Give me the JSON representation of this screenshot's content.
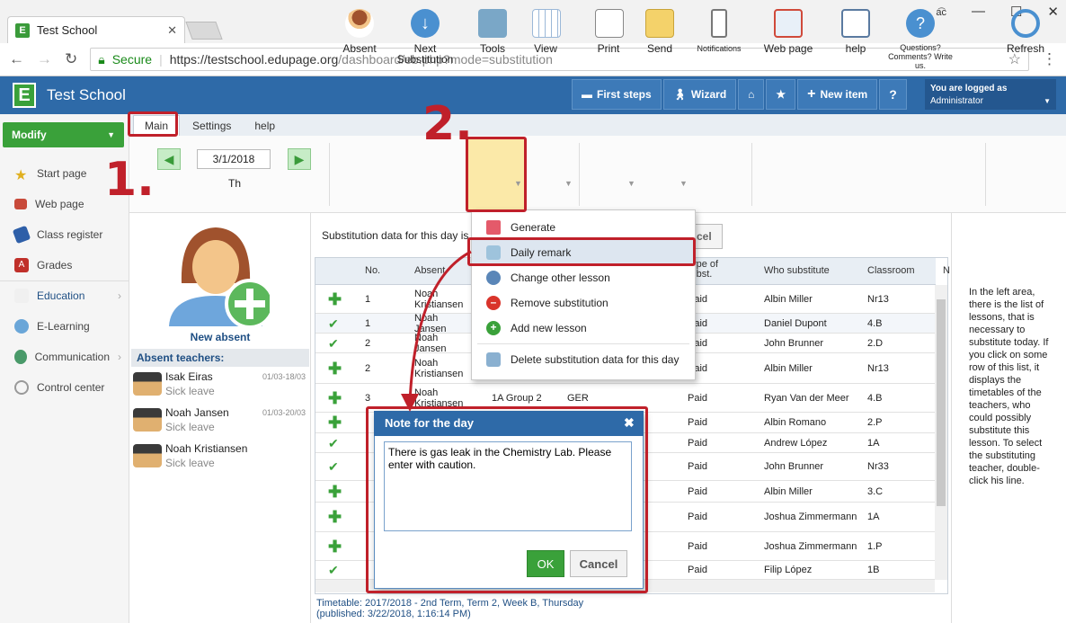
{
  "browser": {
    "tab_title": "Test School",
    "secure_label": "Secure",
    "url_base": "https://testschool.edupage.org",
    "url_path": "/dashboard/eb.php?mode=substitution",
    "win_label": "a͡c"
  },
  "app": {
    "title": "Test School",
    "top_buttons": [
      "First steps",
      "Wizard",
      "New item"
    ],
    "logged_in_label": "You are logged as",
    "logged_in_user": "Administrator"
  },
  "sidebar": {
    "modify_label": "Modify",
    "items": [
      "Start page",
      "Web page",
      "Class register",
      "Grades",
      "Education",
      "E-Learning",
      "Communication",
      "Control center"
    ]
  },
  "tabs": [
    "Main",
    "Settings",
    "help"
  ],
  "ribbon": {
    "date": "3/1/2018",
    "day": "Th",
    "absent": "Absent",
    "next_sub_1": "Next",
    "next_sub_2": "Substitution",
    "tools": "Tools",
    "view": "View",
    "print": "Print",
    "send": "Send",
    "notifications": "Notifications",
    "webpage": "Web page",
    "help": "help",
    "questions": "Questions? Comments? Write us.",
    "refresh": "Refresh"
  },
  "left_panel": {
    "new_absent": "New absent",
    "absent_header": "Absent teachers:",
    "teachers": [
      {
        "name": "Isak Eiras",
        "reason": "Sick leave",
        "dates": "01/03-18/03"
      },
      {
        "name": "Noah Jansen",
        "reason": "Sick leave",
        "dates": "01/03-20/03"
      },
      {
        "name": "Noah Kristiansen",
        "reason": "Sick leave",
        "dates": ""
      }
    ]
  },
  "main": {
    "subtitle": "Substitution data for this day is",
    "cancel_partial": "cel",
    "columns": {
      "no": "No.",
      "absent": "Absent",
      "type": "Type of subst.",
      "who": "Who substitute",
      "room": "Classroom",
      "n": "N"
    },
    "rows": [
      {
        "icon": "plus",
        "no": "1",
        "absent": "Noah Kristiansen",
        "group": "",
        "subj": "",
        "type": "Paid",
        "who": "Albin Miller",
        "room": "Nr13"
      },
      {
        "icon": "check",
        "no": "1",
        "absent": "Noah Jansen",
        "group": "",
        "subj": "",
        "type": "Paid",
        "who": "Daniel Dupont",
        "room": "4.B"
      },
      {
        "icon": "check",
        "no": "2",
        "absent": "Noah Jansen",
        "group": "",
        "subj": "",
        "type": "Paid",
        "who": "John Brunner",
        "room": "2.D"
      },
      {
        "icon": "plus",
        "no": "2",
        "absent": "Noah Kristiansen",
        "group": "",
        "subj": "",
        "type": "Paid",
        "who": "Albin Miller",
        "room": "Nr13"
      },
      {
        "icon": "plus",
        "no": "3",
        "absent": "Noah Kristiansen",
        "group": "1A Group 2",
        "subj": "GER",
        "type": "Paid",
        "who": "Ryan Van der Meer",
        "room": "4.B"
      },
      {
        "icon": "plus",
        "no": "",
        "absent": "",
        "group": "",
        "subj": "",
        "type": "Paid",
        "who": "Albin Romano",
        "room": "2.P"
      },
      {
        "icon": "check",
        "no": "",
        "absent": "",
        "group": "",
        "subj": "",
        "type": "Paid",
        "who": "Andrew López",
        "room": "1A"
      },
      {
        "icon": "check",
        "no": "",
        "absent": "",
        "group": "",
        "subj": "",
        "type": "Paid",
        "who": "John Brunner",
        "room": "Nr33"
      },
      {
        "icon": "plus",
        "no": "",
        "absent": "",
        "group": "",
        "subj": "",
        "type": "Paid",
        "who": "Albin Miller",
        "room": "3.C"
      },
      {
        "icon": "plus",
        "no": "",
        "absent": "",
        "group": "",
        "subj": "",
        "type": "Paid",
        "who": "Joshua Zimmermann",
        "room": "1A"
      },
      {
        "icon": "plus",
        "no": "",
        "absent": "",
        "group": "",
        "subj": "",
        "type": "Paid",
        "who": "Joshua Zimmermann",
        "room": "1.P"
      },
      {
        "icon": "check",
        "no": "",
        "absent": "",
        "group": "",
        "subj": "",
        "type": "Paid",
        "who": "Filip López",
        "room": "1B"
      }
    ],
    "footer_1": "Timetable: 2017/2018 - 2nd Term, Term 2, Week B, Thursday",
    "footer_2": "(published: 3/22/2018, 1:16:14 PM)"
  },
  "help_text": "In the left area, there is the list of lessons, that is necessary to substitute today. If you click on some row of this list, it displays the timetables of the teachers, who could possibly substitute this lesson. To select the substituting teacher, double-click his line.",
  "menu": [
    "Generate",
    "Daily remark",
    "Change other lesson",
    "Remove substitution",
    "Add new lesson",
    "Delete substitution data for this day"
  ],
  "dialog": {
    "title": "Note for the day",
    "text": "There is gas leak in the Chemistry Lab. Please enter with caution.",
    "ok": "OK",
    "cancel": "Cancel"
  },
  "annotations": {
    "step1": "1.",
    "step2": "2."
  },
  "colors": {
    "brand_blue": "#2e6aa8",
    "green": "#3aa13a",
    "annotation_red": "#c0202a"
  }
}
